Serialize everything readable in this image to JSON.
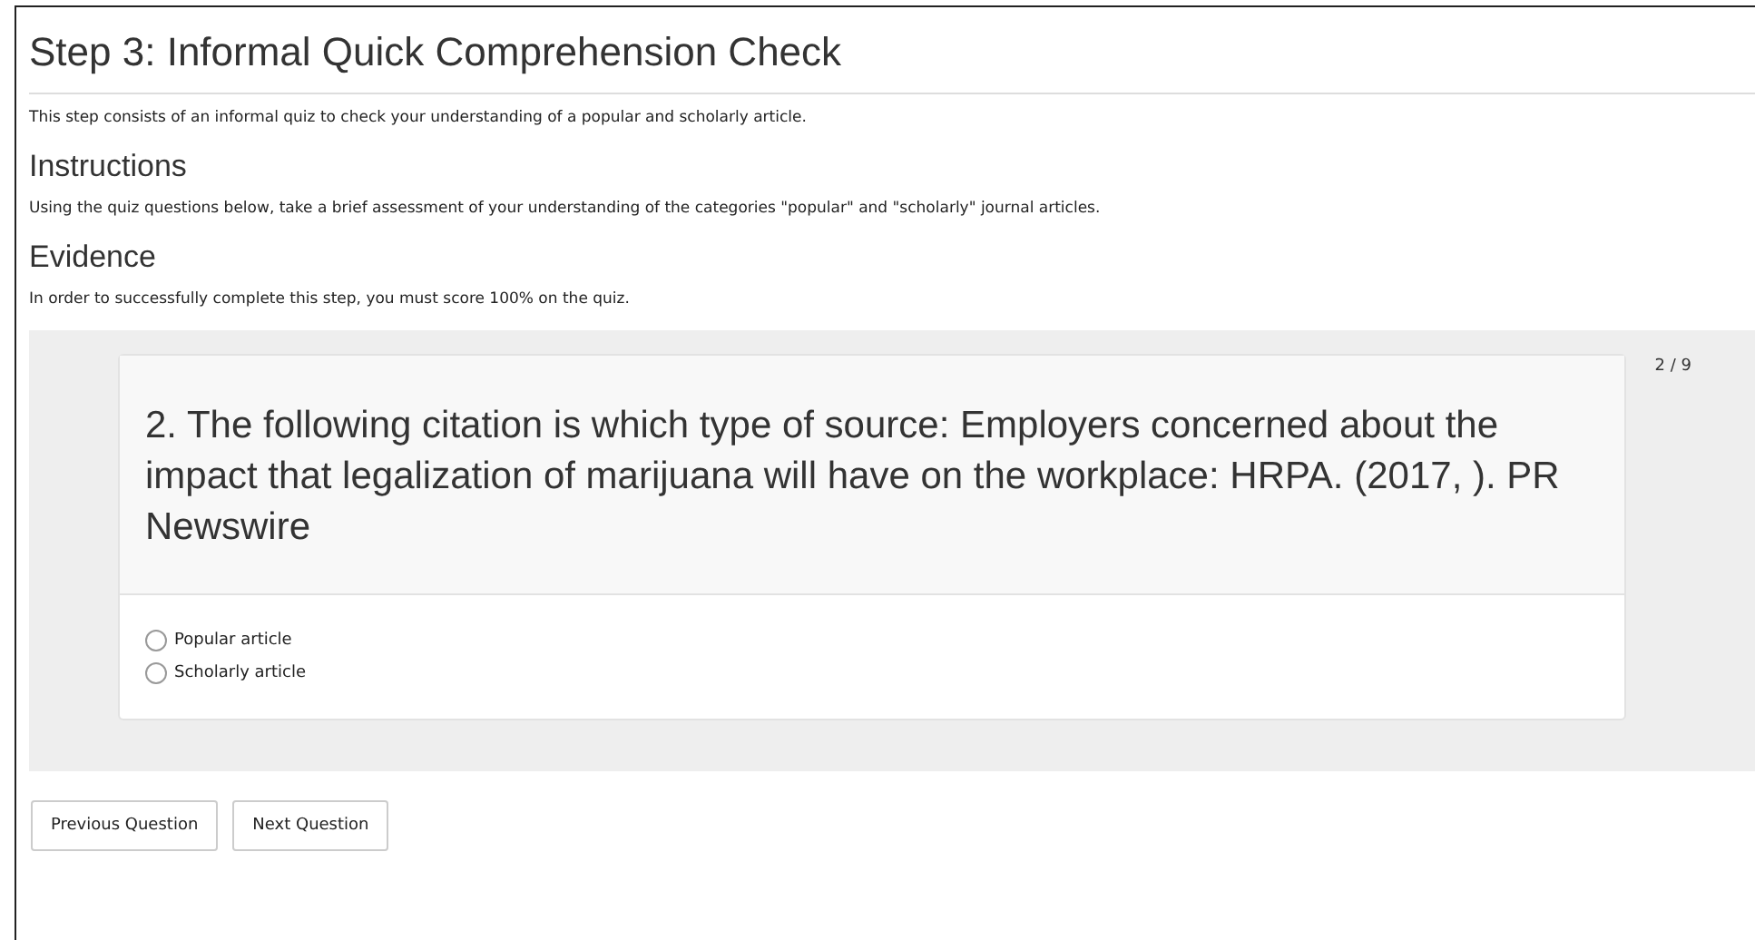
{
  "title": "Step 3: Informal Quick Comprehension Check",
  "intro": "This step consists of an informal quiz to check your understanding of a popular and scholarly article.",
  "sections": [
    {
      "heading": "Instructions",
      "text": "Using the quiz questions below, take a brief assessment of your understanding of the categories \"popular\" and \"scholarly\" journal articles."
    },
    {
      "heading": "Evidence",
      "text": "In order to successfully complete this step, you must score 100% on the quiz."
    }
  ],
  "quiz": {
    "counter": "2 / 9",
    "question": "2. The following citation is which type of source: Employers concerned about the impact that legalization of marijuana will have on the workplace: HRPA. (2017, ). PR Newswire",
    "options": [
      {
        "label": "Popular article",
        "selected": false
      },
      {
        "label": "Scholarly article",
        "selected": false
      }
    ]
  },
  "buttons": [
    "Previous Question",
    "Next Question"
  ]
}
